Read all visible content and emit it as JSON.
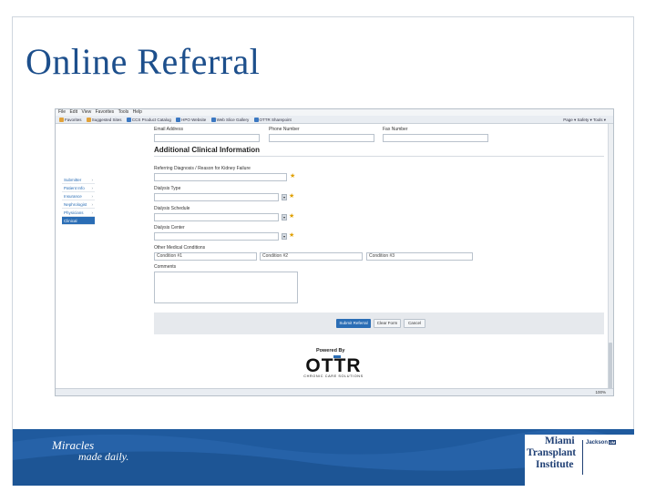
{
  "slide": {
    "title": "Online Referral"
  },
  "browser": {
    "menu": [
      "File",
      "Edit",
      "View",
      "Favorites",
      "Tools",
      "Help"
    ],
    "favorites": [
      "Favorites",
      "Suggested Sites",
      "CCS Product Catalog",
      "HPO Website",
      "Web Slice Gallery",
      "OTTR Sharepoint"
    ],
    "toolbar_right": "Page ▾  Safety ▾  Tools ▾",
    "zoom": "100%"
  },
  "form": {
    "top_labels": {
      "email": "Email Address",
      "phone": "Phone Number",
      "fax": "Fax Number"
    },
    "section_title": "Additional Clinical Information",
    "referring_diagnosis_label": "Referring Diagnosis / Reason for Kidney Failure",
    "dialysis_type_label": "Dialysis Type",
    "dialysis_schedule_label": "Dialysis Schedule",
    "dialysis_center_label": "Dialysis Center",
    "other_conditions_label": "Other Medical Conditions",
    "condition_placeholders": [
      "Condition #1",
      "Condition #2",
      "Condition #3"
    ],
    "comments_label": "Comments"
  },
  "nav": {
    "items": [
      {
        "label": "Submitter",
        "active": false
      },
      {
        "label": "Patient Info",
        "active": false
      },
      {
        "label": "Insurance",
        "active": false
      },
      {
        "label": "Nephrologist",
        "active": false
      },
      {
        "label": "Physicians",
        "active": false
      },
      {
        "label": "Clinical",
        "active": true
      }
    ]
  },
  "actions": {
    "submit": "Submit Referral",
    "clear": "Clear Form",
    "cancel": "Cancel"
  },
  "branding": {
    "powered_by": "Powered By",
    "ottr_logo": "OTTR",
    "ottr_tagline": "CHRONIC CARE SOLUTIONS",
    "footer_line1": "Miracles",
    "footer_line2": "made daily.",
    "institute_line1": "Miami",
    "institute_line2": "Transplant",
    "institute_line3": "Institute",
    "partner": "Jackson",
    "partner_badge": "UM",
    "accent_color": "#2a6db5",
    "footer_color": "#1f5a9e"
  }
}
